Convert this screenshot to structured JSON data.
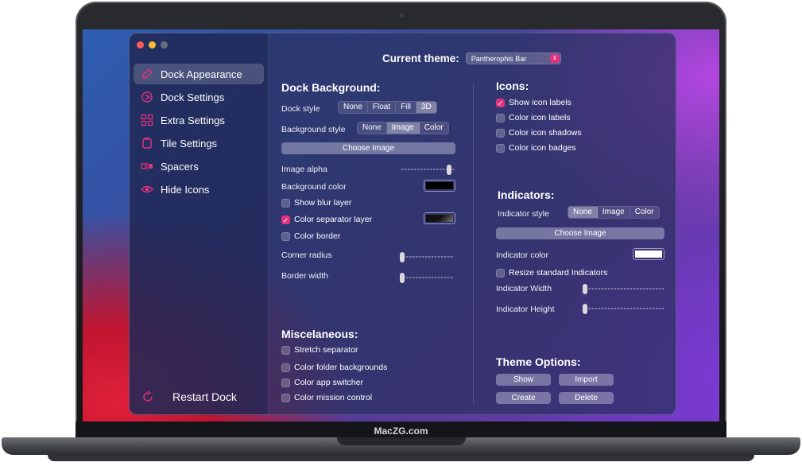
{
  "brand": "MacZG.com",
  "sidebar": {
    "items": [
      {
        "label": "Dock Appearance",
        "icon": "brush-icon",
        "active": true
      },
      {
        "label": "Dock Settings",
        "icon": "dock-settings-icon",
        "active": false
      },
      {
        "label": "Extra Settings",
        "icon": "grid-icon",
        "active": false
      },
      {
        "label": "Tile Settings",
        "icon": "tile-icon",
        "active": false
      },
      {
        "label": "Spacers",
        "icon": "spacer-icon",
        "active": false
      },
      {
        "label": "Hide Icons",
        "icon": "eye-icon",
        "active": false
      }
    ],
    "restart_label": "Restart Dock"
  },
  "theme": {
    "label": "Current theme:",
    "value": "Pantherophis Bar",
    "arrow": "⇕"
  },
  "dock_background": {
    "title": "Dock Background:",
    "dock_style_label": "Dock style",
    "dock_style_options": [
      "None",
      "Float",
      "Fill",
      "3D"
    ],
    "dock_style_selected": "3D",
    "bg_style_label": "Background style",
    "bg_style_options": [
      "None",
      "Image",
      "Color"
    ],
    "bg_style_selected": "Image",
    "choose_image": "Choose Image",
    "image_alpha_label": "Image alpha",
    "image_alpha_value": 0.95,
    "bg_color_label": "Background color",
    "bg_color": "#000000",
    "show_blur_label": "Show blur layer",
    "show_blur_checked": false,
    "color_separator_label": "Color separator layer",
    "color_separator_checked": true,
    "color_border_label": "Color border",
    "color_border_checked": false,
    "corner_radius_label": "Corner radius",
    "corner_radius_value": 0,
    "border_width_label": "Border width",
    "border_width_value": 0
  },
  "misc": {
    "title": "Miscelaneous:",
    "items": [
      {
        "label": "Stretch separator",
        "checked": false
      },
      {
        "label": "Color folder backgrounds",
        "checked": false
      },
      {
        "label": "Color app switcher",
        "checked": false
      },
      {
        "label": "Color mission control",
        "checked": false
      }
    ]
  },
  "icons": {
    "title": "Icons:",
    "items": [
      {
        "label": "Show icon labels",
        "checked": true
      },
      {
        "label": "Color icon labels",
        "checked": false
      },
      {
        "label": "Color icon shadows",
        "checked": false
      },
      {
        "label": "Color icon badges",
        "checked": false
      }
    ]
  },
  "indicators": {
    "title": "Indicators:",
    "style_label": "Indicator style",
    "style_options": [
      "None",
      "Image",
      "Color"
    ],
    "style_selected": "None",
    "choose_image": "Choose Image",
    "color_label": "Indicator color",
    "color": "#ffffff",
    "resize_label": "Resize standard Indicators",
    "resize_checked": false,
    "width_label": "Indicator Width",
    "width_value": 0,
    "height_label": "Indicator Height",
    "height_value": 0
  },
  "theme_options": {
    "title": "Theme Options:",
    "show": "Show",
    "import": "Import",
    "create": "Create",
    "delete": "Delete"
  },
  "colors": {
    "accent": "#e0337e"
  }
}
